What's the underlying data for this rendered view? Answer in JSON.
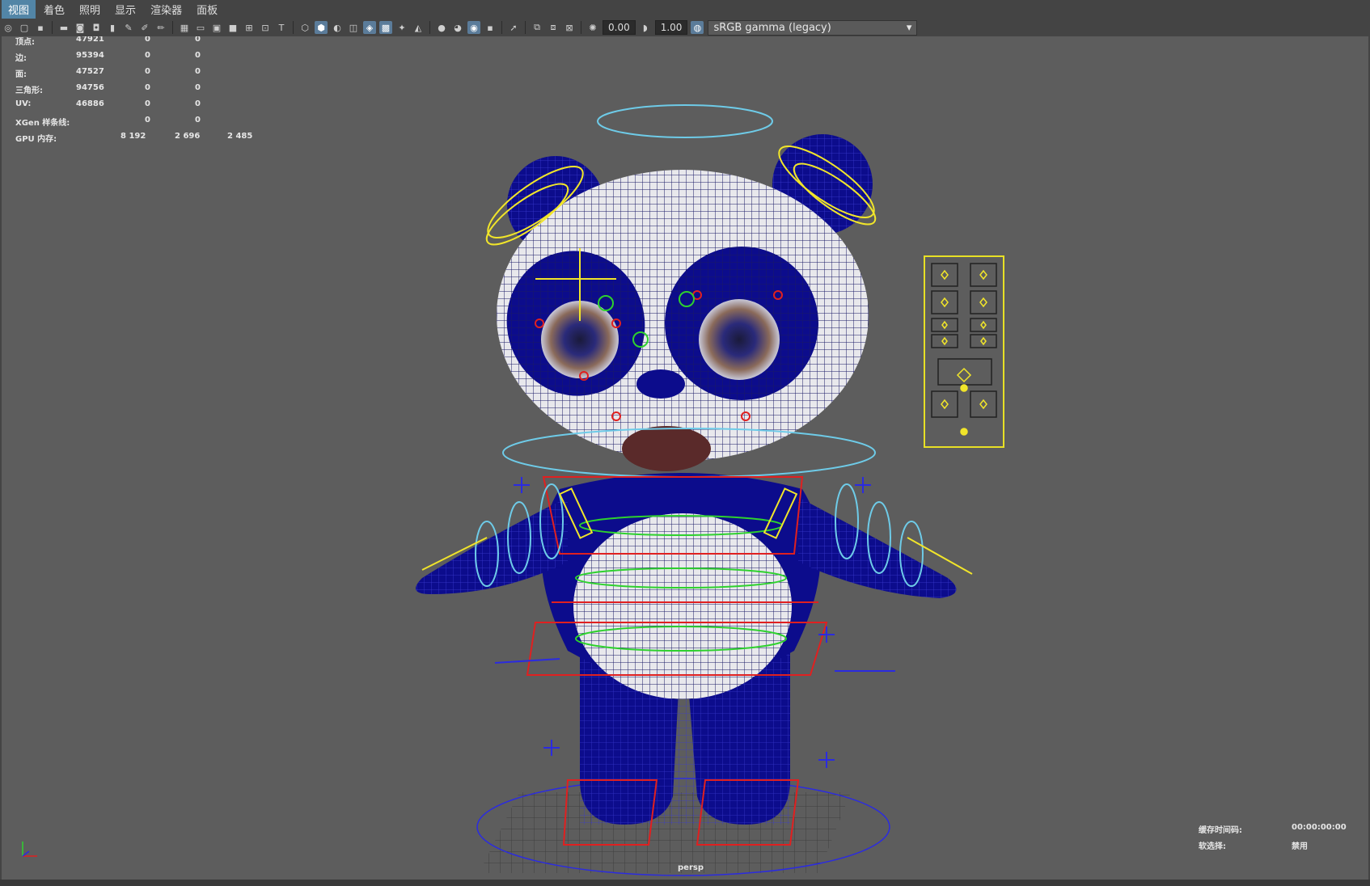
{
  "menubar": {
    "items": [
      {
        "label": "视图",
        "active": true
      },
      {
        "label": "着色",
        "active": false
      },
      {
        "label": "照明",
        "active": false
      },
      {
        "label": "显示",
        "active": false
      },
      {
        "label": "渲染器",
        "active": false
      },
      {
        "label": "面板",
        "active": false
      }
    ]
  },
  "toolbar": {
    "exposure_value": "0.00",
    "gamma_value": "1.00",
    "colorspace": "sRGB gamma (legacy)",
    "icons": [
      "camera-select-icon",
      "lock-camera-icon",
      "bookmark-icon",
      "image-plane-icon",
      "grid-icon",
      "film-gate-icon",
      "resolution-gate-icon",
      "gate-mask-icon",
      "field-chart-icon",
      "safe-action-icon",
      "safe-title-icon",
      "wireframe-icon",
      "smooth-shade-icon",
      "default-material-icon",
      "lighting-icon",
      "shadows-icon",
      "screen-space-ao-icon",
      "motion-blur-icon",
      "anti-alias-icon",
      "depth-of-field-icon",
      "isolate-select-icon",
      "xray-icon",
      "xray-joints-icon",
      "backface-icon",
      "exposure-icon",
      "gamma-icon",
      "view-transform-icon"
    ]
  },
  "hud": {
    "stats": [
      {
        "label": "顶点:",
        "a": "47921",
        "b": "0",
        "c": "0"
      },
      {
        "label": "边:",
        "a": "95394",
        "b": "0",
        "c": "0"
      },
      {
        "label": "面:",
        "a": "47527",
        "b": "0",
        "c": "0"
      },
      {
        "label": "三角形:",
        "a": "94756",
        "b": "0",
        "c": "0"
      },
      {
        "label": "UV:",
        "a": "46886",
        "b": "0",
        "c": "0"
      },
      {
        "label": "XGen 样条线:",
        "a": "",
        "b": "0",
        "c": "0"
      },
      {
        "label": "GPU 内存:",
        "a": "8 192",
        "b": "2 696",
        "c": "2 485"
      }
    ],
    "bottom": {
      "cache_label": "缓存时间码:",
      "cache_value": "00:00:00:00",
      "soft_select_label": "软选择:",
      "soft_select_value": "禁用"
    },
    "camera": "persp"
  },
  "colors": {
    "mesh_fill": "#0c0c8c",
    "mesh_white": "#e8e8ec",
    "control_yellow": "#f1e52a",
    "control_red": "#e02020",
    "control_cyan": "#6ecbe8",
    "control_green": "#2ed12e",
    "control_blue": "#2b2be0"
  }
}
